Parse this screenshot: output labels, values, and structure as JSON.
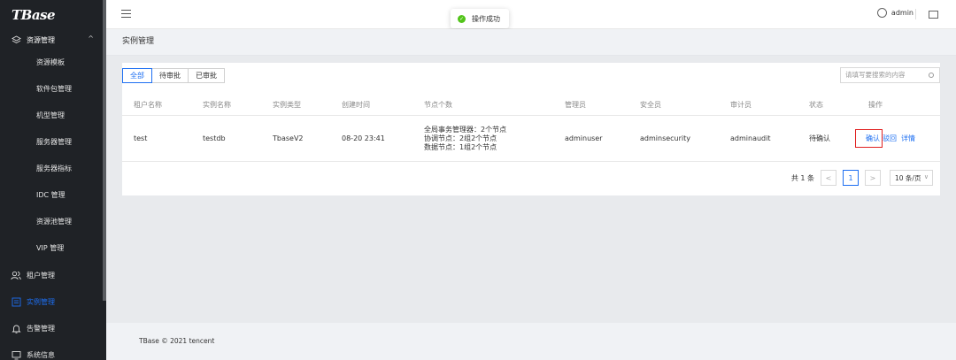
{
  "sidebar": {
    "logo": "TBase",
    "group": {
      "label": "资源管理",
      "icon": "layers-icon",
      "caret": "^"
    },
    "sub_items": [
      {
        "label": "资源模板"
      },
      {
        "label": "软件包管理"
      },
      {
        "label": "机型管理"
      },
      {
        "label": "服务器管理"
      },
      {
        "label": "服务器指标"
      },
      {
        "label": "IDC 管理"
      },
      {
        "label": "资源池管理"
      },
      {
        "label": "VIP 管理"
      }
    ],
    "top_items": [
      {
        "label": "租户管理",
        "icon": "users-icon"
      },
      {
        "label": "实例管理",
        "icon": "instance-icon",
        "active": true
      },
      {
        "label": "告警管理",
        "icon": "bell-icon"
      },
      {
        "label": "系统信息",
        "icon": "monitor-icon"
      }
    ]
  },
  "header": {
    "toast": "操作成功",
    "user": "admin"
  },
  "breadcrumb": "实例管理",
  "tabs": [
    "全部",
    "待审批",
    "已审批"
  ],
  "search": {
    "placeholder": "请填写要搜索的内容"
  },
  "table": {
    "headers": [
      "租户名称",
      "实例名称",
      "实例类型",
      "创建时间",
      "节点个数",
      "管理员",
      "安全员",
      "审计员",
      "状态",
      "操作"
    ],
    "rows": [
      {
        "tenant": "test",
        "instance": "testdb",
        "type": "TbaseV2",
        "created": "08-20 23:41",
        "nodes": [
          "全局事务管理器：2个节点",
          "协调节点：2组2个节点",
          "数据节点：1组2个节点"
        ],
        "admin": "adminuser",
        "security": "adminsecurity",
        "auditor": "adminaudit",
        "status": "待确认",
        "ops": {
          "confirm": "确认",
          "reject": "驳回",
          "detail": "详情"
        }
      }
    ]
  },
  "pagination": {
    "total": "共 1 条",
    "prev": "<",
    "current": "1",
    "next": ">",
    "page_size": "10 条/页"
  },
  "footer": "TBase © 2021 tencent",
  "colors": {
    "accent": "#1d6ff2",
    "sidebar_bg": "#1f2226",
    "success": "#52c41a",
    "highlight_box": "#e02020"
  }
}
